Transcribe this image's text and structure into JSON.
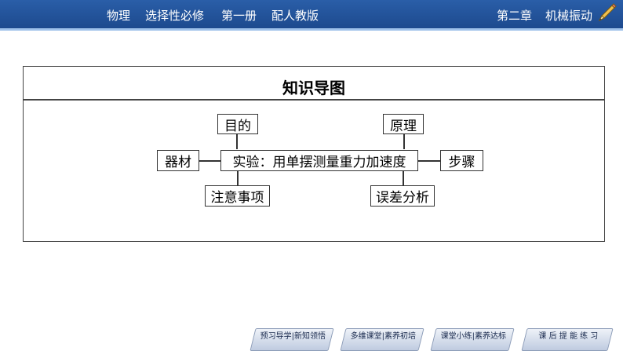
{
  "header": {
    "subject": "物理",
    "book": "选择性必修",
    "volume": "第一册",
    "edition": "配人教版",
    "chapter": "第二章",
    "chapter_title": "机械振动"
  },
  "mindmap": {
    "title": "知识导图",
    "center": "实验：用单摆测量重力加速度",
    "top_left": "目的",
    "top_right": "原理",
    "left": "器材",
    "right": "步骤",
    "bottom_left": "注意事项",
    "bottom_right": "误差分析"
  },
  "nav": {
    "items": [
      "预习导学|新知领悟",
      "多维课堂|素养初培",
      "课堂小练|素养达标",
      "课 后 提 能 练 习"
    ]
  },
  "icons": {
    "header": "pencil-icon"
  },
  "colors": {
    "header_bg": "#1d4a8e",
    "header_line": "#9ec1ea",
    "nav_bg": "#bfcbe0"
  }
}
